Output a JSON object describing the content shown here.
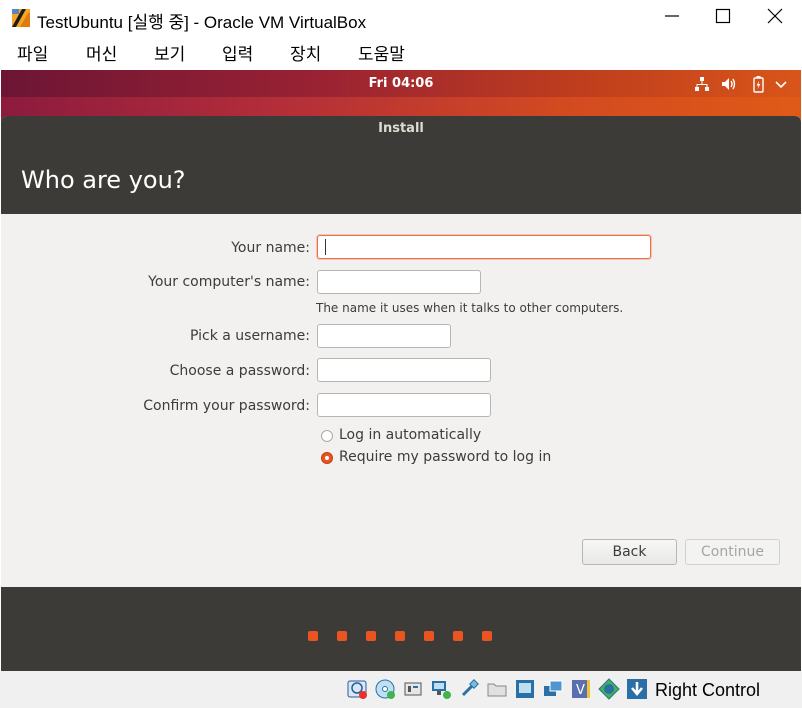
{
  "window": {
    "title": "TestUbuntu [실행 중] - Oracle VM VirtualBox",
    "icon": "virtualbox-logo-icon",
    "controls": [
      "minimize-icon",
      "maximize-icon",
      "close-icon"
    ]
  },
  "menubar": {
    "items": [
      "파일",
      "머신",
      "보기",
      "입력",
      "장치",
      "도움말"
    ]
  },
  "ubuntu_topbar": {
    "clock": "Fri 04:06",
    "tray_icons": [
      "network-icon",
      "volume-icon",
      "battery-icon",
      "power-menu-icon"
    ]
  },
  "installer": {
    "window_title": "Install",
    "heading": "Who are you?",
    "fields": {
      "your_name": {
        "label": "Your name:",
        "value": ""
      },
      "computer_name": {
        "label": "Your computer's name:",
        "value": "",
        "hint": "The name it uses when it talks to other computers."
      },
      "username": {
        "label": "Pick a username:",
        "value": ""
      },
      "password": {
        "label": "Choose a password:",
        "value": ""
      },
      "confirm_password": {
        "label": "Confirm your password:",
        "value": ""
      }
    },
    "login_options": {
      "auto": {
        "label": "Log in automatically",
        "selected": false
      },
      "require_password": {
        "label": "Require my password to log in",
        "selected": true
      }
    },
    "buttons": {
      "back": "Back",
      "continue": "Continue"
    },
    "progress": {
      "steps": 7,
      "color": "#e95420"
    }
  },
  "statusbar": {
    "icons": [
      "hard-disk-icon",
      "optical-drive-icon",
      "audio-icon",
      "network-adapter-icon",
      "usb-icon",
      "shared-folders-icon",
      "display-icon",
      "video-capture-icon",
      "recording-icon",
      "cpu-icon",
      "mouse-integration-icon",
      "keyboard-capture-icon"
    ],
    "host_key": "Right Control"
  },
  "colors": {
    "accent": "#e95420",
    "installer_dark": "#3c3b37",
    "installer_bg": "#f2f1f0"
  }
}
